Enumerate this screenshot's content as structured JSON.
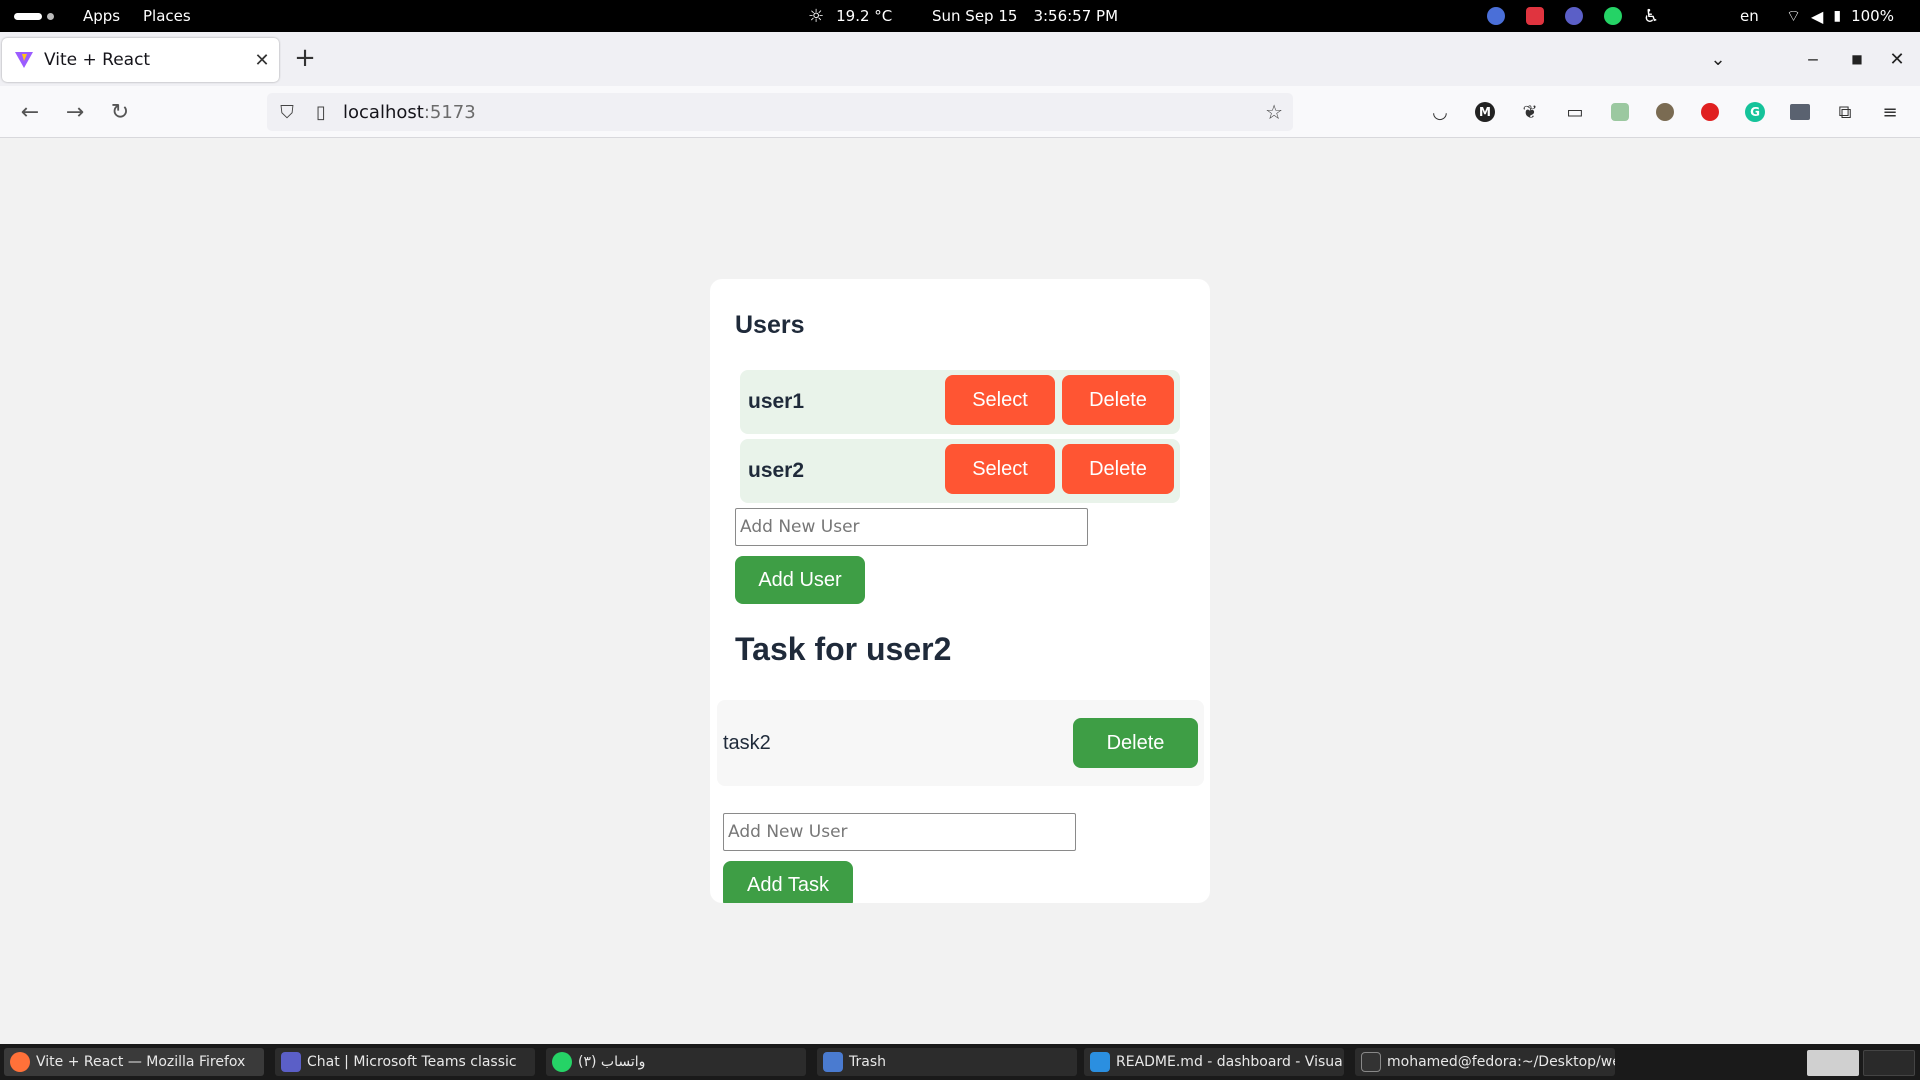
{
  "topbar": {
    "apps_label": "Apps",
    "places_label": "Places",
    "temperature": "19.2 °C",
    "date": "Sun Sep 15",
    "time": "3:56:57 PM",
    "language": "en",
    "battery": "100%"
  },
  "browser": {
    "tab_title": "Vite + React",
    "url_host": "localhost",
    "url_port": ":5173"
  },
  "page": {
    "users_heading": "Users",
    "users": [
      {
        "name": "user1",
        "select_label": "Select",
        "delete_label": "Delete"
      },
      {
        "name": "user2",
        "select_label": "Select",
        "delete_label": "Delete"
      }
    ],
    "user_input_placeholder": "Add New User",
    "add_user_label": "Add User",
    "task_heading": "Task for user2",
    "tasks": [
      {
        "name": "task2",
        "delete_label": "Delete"
      }
    ],
    "task_input_placeholder": "Add New User",
    "add_task_label": "Add Task",
    "colors": {
      "danger": "#ff5533",
      "success": "#3e9e45",
      "user_row_bg": "#e9f3ea"
    }
  },
  "taskbar": {
    "items": [
      {
        "label": "Vite + React — Mozilla Firefox"
      },
      {
        "label": "Chat | Microsoft Teams classic"
      },
      {
        "label": "(٣) واتساب"
      },
      {
        "label": "Trash"
      },
      {
        "label": "README.md - dashboard - Visual ..."
      },
      {
        "label": "mohamed@fedora:~/Desktop/we..."
      }
    ]
  }
}
